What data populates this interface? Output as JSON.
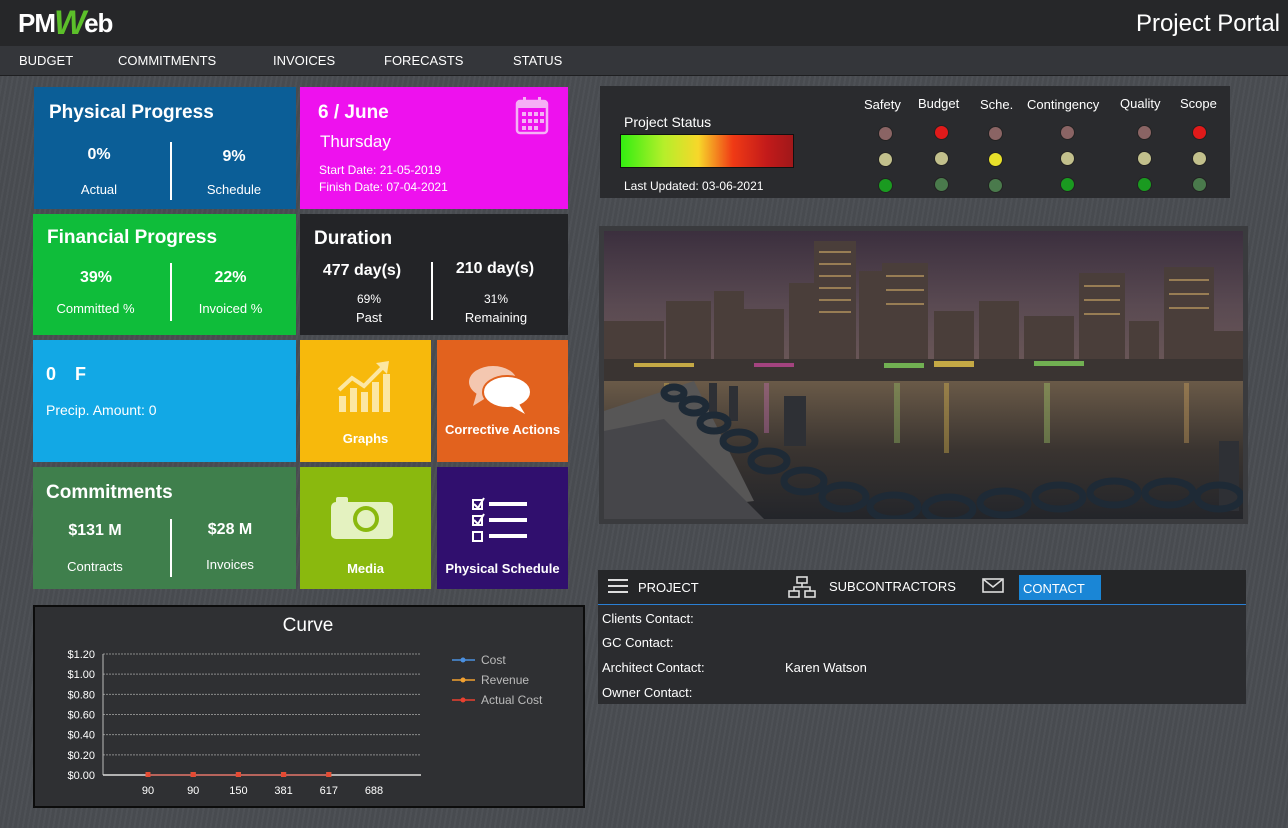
{
  "header": {
    "logo_text_a": "PM",
    "logo_text_w": "W",
    "logo_text_b": "eb",
    "portal_title": "Project Portal"
  },
  "nav": [
    "BUDGET",
    "COMMITMENTS",
    "INVOICES",
    "FORECASTS",
    "STATUS"
  ],
  "physical_progress": {
    "title": "Physical Progress",
    "actual_value": "0%",
    "actual_label": "Actual",
    "schedule_value": "9%",
    "schedule_label": "Schedule",
    "color": "#0b5e97"
  },
  "date_tile": {
    "date": "6 / June",
    "weekday": "Thursday",
    "start": "Start Date: 21-05-2019",
    "finish": "Finish Date: 07-04-2021",
    "icon": "calendar-icon",
    "color": "#ee11ee"
  },
  "financial_progress": {
    "title": "Financial Progress",
    "committed_value": "39%",
    "committed_label": "Committed %",
    "invoiced_value": "22%",
    "invoiced_label": "Invoiced %",
    "color": "#0fbd3a"
  },
  "duration": {
    "title": "Duration",
    "past_days": "477 day(s)",
    "past_pct": "69%",
    "past_label": "Past",
    "remaining_days": "210 day(s)",
    "remaining_pct": "31%",
    "remaining_label": "Remaining",
    "color": "#232427"
  },
  "weather": {
    "temp": "0",
    "unit": "F",
    "precip": "Precip. Amount: 0",
    "color": "#12a8e5"
  },
  "graphs_tile": {
    "label": "Graphs",
    "icon": "chart-icon",
    "color": "#f7b90c"
  },
  "corrective_tile": {
    "label": "Corrective Actions",
    "icon": "chat-bubbles-icon",
    "color": "#e2621e"
  },
  "commitments": {
    "title": "Commitments",
    "contracts_value": "$131 M",
    "contracts_label": "Contracts",
    "invoices_value": "$28 M",
    "invoices_label": "Invoices",
    "color": "#3f7f4c"
  },
  "media_tile": {
    "label": "Media",
    "icon": "camera-icon",
    "color": "#8ab90e"
  },
  "schedule_tile": {
    "label": "Physical Schedule",
    "icon": "checklist-icon",
    "color": "#300f6e"
  },
  "project_status": {
    "title": "Project Status",
    "last_updated": "Last Updated: 03-06-2021",
    "columns": [
      "Safety",
      "Budget",
      "Sche.",
      "Contingency",
      "Quality",
      "Scope"
    ],
    "active": [
      "green",
      "red",
      "yellow",
      "green",
      "green",
      "red"
    ]
  },
  "contact": {
    "tabs": [
      {
        "label": "PROJECT",
        "icon": "menu-icon"
      },
      {
        "label": "SUBCONTRACTORS",
        "icon": "org-chart-icon"
      },
      {
        "label": "CONTACT",
        "icon": "envelope-icon"
      }
    ],
    "rows": [
      {
        "label": "Clients Contact:",
        "value": ""
      },
      {
        "label": "GC Contact:",
        "value": ""
      },
      {
        "label": "Architect Contact:",
        "value": "Karen Watson"
      },
      {
        "label": "Owner Contact:",
        "value": ""
      }
    ]
  },
  "chart_data": {
    "type": "line",
    "title": "Curve",
    "categories": [
      "90",
      "90",
      "150",
      "381",
      "617",
      "688"
    ],
    "yticks": [
      "$0.00",
      "$0.20",
      "$0.40",
      "$0.60",
      "$0.80",
      "$1.00",
      "$1.20"
    ],
    "ylim": [
      0,
      1.2
    ],
    "grid": true,
    "legend_position": "right",
    "series": [
      {
        "name": "Cost",
        "values": [
          0,
          0,
          0,
          0,
          0,
          null
        ],
        "color": "#4a8fe0"
      },
      {
        "name": "Revenue",
        "values": [
          0,
          0,
          0,
          0,
          0,
          null
        ],
        "color": "#f0a030"
      },
      {
        "name": "Actual Cost",
        "values": [
          0,
          0,
          0,
          0,
          0,
          null
        ],
        "color": "#e84030"
      }
    ]
  }
}
